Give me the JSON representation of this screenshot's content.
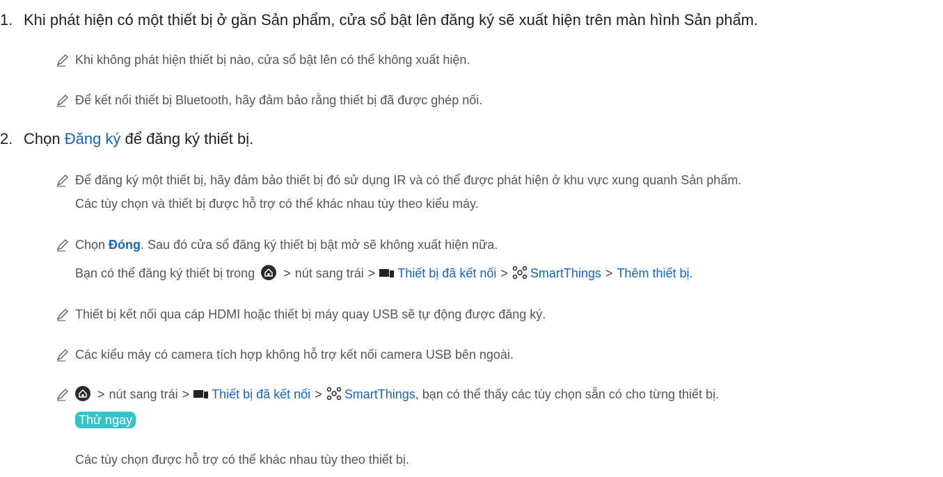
{
  "steps": [
    {
      "num": "1.",
      "text": "Khi phát hiện có một thiết bị ở gần Sản phẩm, cửa sổ bật lên đăng ký sẽ xuất hiện trên màn hình Sản phẩm."
    },
    {
      "num": "2.",
      "pre": "Chọn ",
      "link": "Đăng ký",
      "post": " để đăng ký thiết bị."
    }
  ],
  "notes1": [
    "Khi không phát hiện thiết bị nào, cửa sổ bật lên có thể không xuất hiện.",
    "Để kết nối thiết bị Bluetooth, hãy đảm bảo rằng thiết bị đã được ghép nối."
  ],
  "notes2": {
    "n1_line1": "Để đăng ký một thiết bị, hãy đảm bảo thiết bị đó sử dụng IR và có thể được phát hiện ở khu vực xung quanh Sản phẩm.",
    "n1_line2": "Các tùy chọn và thiết bị được hỗ trợ có thể khác nhau tùy theo kiểu máy.",
    "n2_pre": "Chọn ",
    "n2_link": "Đóng",
    "n2_post": ". Sau đó cửa sổ đăng ký thiết bị bật mở sẽ không xuất hiện nữa.",
    "path_pre": "Bạn có thể đăng ký thiết bị trong ",
    "path_left": "nút sang trái",
    "path_connected": "Thiết bị đã kết nối",
    "path_smartthings": "SmartThings",
    "path_add": "Thêm thiết bị",
    "path_end": ".",
    "n3": "Thiết bị kết nối qua cáp HDMI hoặc thiết bị máy quay USB sẽ tự động được đăng ký.",
    "n4": "Các kiểu máy có camera tích hợp không hỗ trợ kết nối camera USB bên ngoài.",
    "n5_left": "nút sang trái",
    "n5_connected": "Thiết bị đã kết nối",
    "n5_smartthings": "SmartThings",
    "n5_post": ", bạn có thể thấy các tùy chọn sẵn có cho từng thiết bị.",
    "try_now": "Thử ngay",
    "n5_last": "Các tùy chọn được hỗ trợ có thể khác nhau tùy theo thiết bị."
  },
  "separator": ">",
  "icons": [
    "pencil-icon",
    "home-icon",
    "connected-devices-icon",
    "smartthings-icon"
  ],
  "colors": {
    "link": "#1565c0",
    "badge": "#34c3c8"
  }
}
